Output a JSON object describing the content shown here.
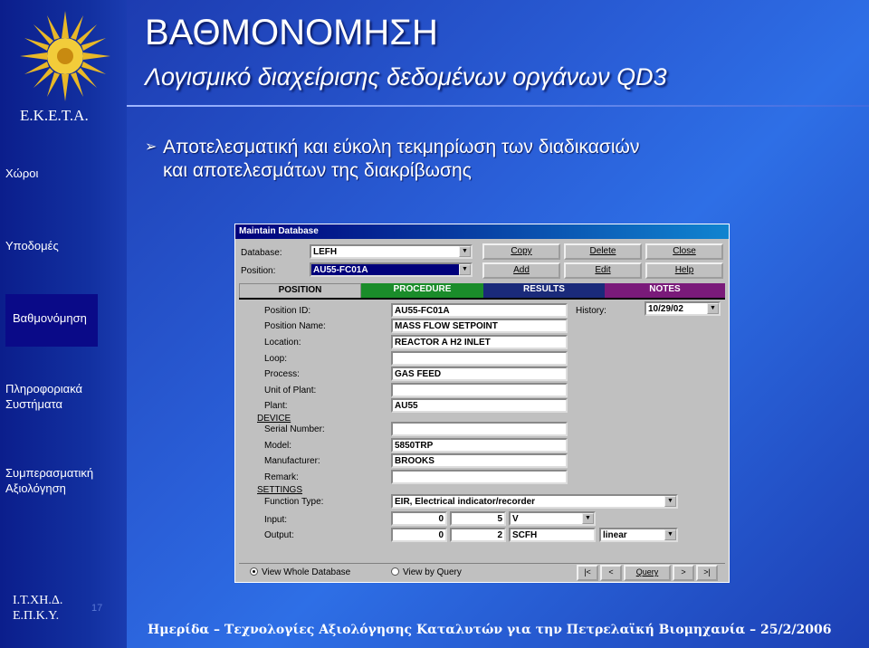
{
  "slide": {
    "title": "ΒΑΘΜΟΝΟΜΗΣΗ",
    "subtitle": "Λογισμικό διαχείρισης δεδομένων οργάνων QD3",
    "bullet_line1": "Αποτελεσματική και εύκολη τεκμηρίωση των διαδικασιών",
    "bullet_line2": "και αποτελεσμάτων της διακρίβωσης",
    "bullet_icon": "arrow-bullet-icon",
    "logo_text": "Ε.Κ.Ε.Τ.Α.",
    "bottom_left_1": "Ι.Τ.ΧΗ.Δ.",
    "bottom_left_2": "Ε.Π.Κ.Υ.",
    "slide_number": "17",
    "footer": "Ημερίδα – Τεχνολογίες Αξιολόγησης Καταλυτών για την Πετρελαϊκή Βιομηχανία – 25/2/2006",
    "nav": [
      {
        "label": "Χώροι"
      },
      {
        "label": "Υποδομές"
      },
      {
        "label": "Βαθμονόμηση"
      },
      {
        "label": "Πληροφοριακά Συστήματα"
      },
      {
        "label": "Συμπερασματική Αξιολόγηση"
      }
    ]
  },
  "app": {
    "window_title": "Maintain Database",
    "database_label": "Database:",
    "database_value": "LEFH",
    "position_label": "Position:",
    "position_value": "AU55-FC01A",
    "buttons": {
      "copy": "Copy",
      "delete": "Delete",
      "close": "Close",
      "add": "Add",
      "edit": "Edit",
      "help": "Help"
    },
    "tabs": [
      {
        "label": "POSITION",
        "color": "#c0c0c0"
      },
      {
        "label": "PROCEDURE",
        "color": "#1a8c2a"
      },
      {
        "label": "RESULTS",
        "color": "#1a2a7a"
      },
      {
        "label": "NOTES",
        "color": "#7a1a7a"
      }
    ],
    "fields": {
      "position_id_label": "Position ID:",
      "position_id": "AU55-FC01A",
      "position_name_label": "Position Name:",
      "position_name": "MASS FLOW SETPOINT",
      "location_label": "Location:",
      "location": "REACTOR A H2 INLET",
      "loop_label": "Loop:",
      "loop": "",
      "process_label": "Process:",
      "process": "GAS FEED",
      "unit_label": "Unit of Plant:",
      "unit": "",
      "plant_label": "Plant:",
      "plant": "AU55",
      "device_label": "DEVICE",
      "serial_label": "Serial Number:",
      "serial": "",
      "model_label": "Model:",
      "model": "5850TRP",
      "manufacturer_label": "Manufacturer:",
      "manufacturer": "BROOKS",
      "remark_label": "Remark:",
      "remark": "",
      "settings_label": "SETTINGS",
      "function_label": "Function Type:",
      "function": "EIR, Electrical indicator/recorder",
      "input_label": "Input:",
      "input_min": "0",
      "input_max": "5",
      "input_unit": "V",
      "output_label": "Output:",
      "output_min": "0",
      "output_max": "2",
      "output_unit": "SCFH",
      "output_curve": "linear",
      "history_label": "History:",
      "history": "10/29/02"
    },
    "radio_whole": "View Whole Database",
    "radio_query": "View by Query",
    "nav_first": "|<",
    "nav_prev": "<",
    "query_button": "Query",
    "nav_next": ">",
    "nav_last": ">|"
  }
}
